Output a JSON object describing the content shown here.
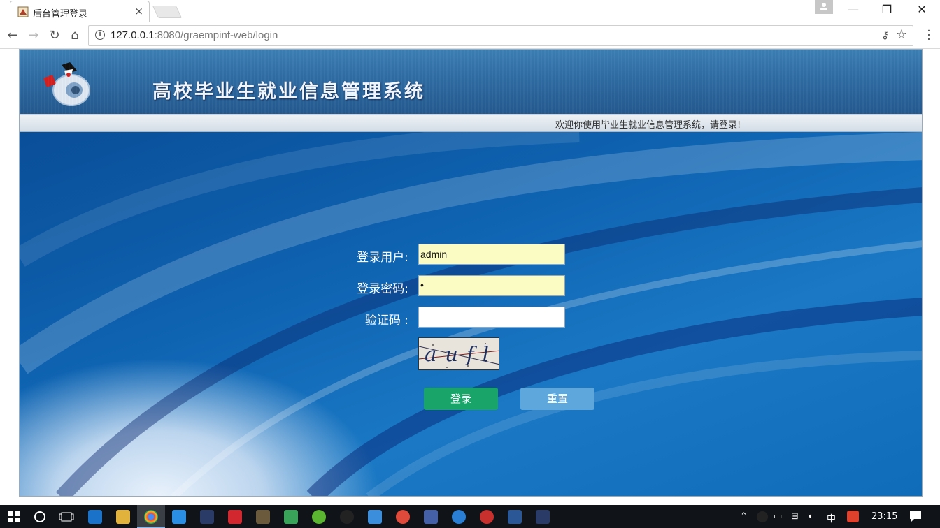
{
  "browser": {
    "tab_title": "后台管理登录",
    "tab_close": "×",
    "url_host": "127.0.0.1",
    "url_rest": ":8080/graempinf-web/login",
    "window_controls": {
      "minimize": "—",
      "restore": "❐",
      "close": "✕"
    }
  },
  "header": {
    "system_title": "高校毕业生就业信息管理系统",
    "welcome": "欢迎你使用毕业生就业信息管理系统，请登录!"
  },
  "login_form": {
    "username_label": "登录用户:",
    "username_value": "admin",
    "password_label": "登录密码:",
    "password_value": "•",
    "captcha_label": "验证码 :",
    "captcha_value": "",
    "captcha_image_text": "aufl",
    "login_button": "登录",
    "reset_button": "重置"
  },
  "taskbar": {
    "ime": "中",
    "clock": "23:15"
  },
  "colors": {
    "login_button": "#19a56a",
    "reset_button": "#5ea7dd",
    "autofill_bg": "#fbfcc4",
    "banner": "#2f6ca3"
  }
}
